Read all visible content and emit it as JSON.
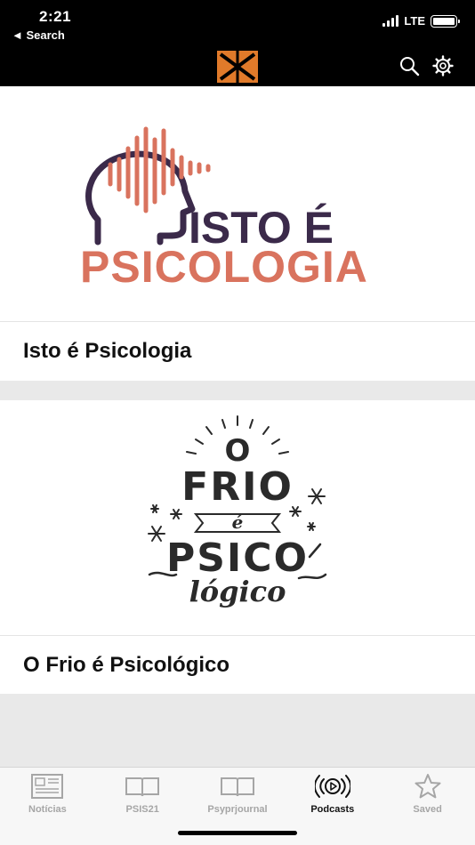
{
  "status_bar": {
    "time": "2:21",
    "back_label": "◄ Search",
    "network": "LTE"
  },
  "header": {
    "logo_icon": "app-logo-icon",
    "search_icon": "search-icon",
    "settings_icon": "gear-icon",
    "logo_color": "#e07a2a"
  },
  "podcasts": [
    {
      "title": "Isto é Psicologia",
      "art": {
        "line1": "ISTO É",
        "line2": "PSICOLOGIA",
        "primary_color": "#3b2a4a",
        "accent_color": "#d9735e"
      }
    },
    {
      "title": "O Frio é Psicológico",
      "art": {
        "line1": "O",
        "line2": "FRIO",
        "line3": "é",
        "line4": "PSICO",
        "line5": "lógico",
        "ink_color": "#2a2a2a"
      }
    }
  ],
  "tabs": [
    {
      "label": "Notícias",
      "icon": "newspaper-icon",
      "active": false
    },
    {
      "label": "PSIS21",
      "icon": "book-icon",
      "active": false
    },
    {
      "label": "Psyprjournal",
      "icon": "book-icon",
      "active": false
    },
    {
      "label": "Podcasts",
      "icon": "podcast-icon",
      "active": true
    },
    {
      "label": "Saved",
      "icon": "star-icon",
      "active": false
    }
  ]
}
